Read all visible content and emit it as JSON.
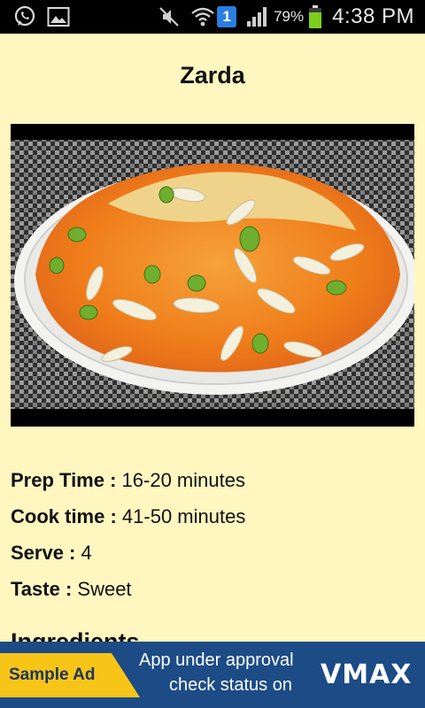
{
  "status_bar": {
    "battery_percent": "79%",
    "time": "4:38 PM",
    "notification_badge": "1",
    "icons": [
      "whatsapp-icon",
      "gallery-icon",
      "mute-icon",
      "wifi-icon",
      "notification-badge",
      "signal-icon",
      "battery-icon"
    ],
    "battery_color": "#7ccf1c"
  },
  "recipe": {
    "title": "Zarda",
    "image_alt": "Zarda",
    "details": [
      {
        "label": "Prep Time :",
        "value": " 16-20 minutes"
      },
      {
        "label": "Cook time :",
        "value": " 41-50 minutes"
      },
      {
        "label": "Serve :",
        "value": " 4"
      },
      {
        "label": "Taste :",
        "value": " Sweet"
      }
    ],
    "ingredients_heading": "Ingredients"
  },
  "ad": {
    "badge_label": "Sample Ad",
    "line1": "App under approval",
    "line2": "check status on",
    "logo": "VMAX",
    "background": "#1c4b86",
    "badge_color": "#f7c518"
  },
  "theme": {
    "page_background": "#fff6c0",
    "text_color": "#111111"
  }
}
